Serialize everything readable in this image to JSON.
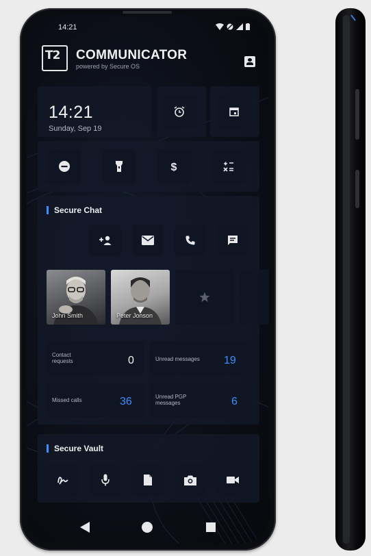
{
  "status_bar": {
    "time": "14:21"
  },
  "header": {
    "title": "COMMUNICATOR",
    "subtitle": "powered by Secure OS",
    "logo": "T2"
  },
  "clock": {
    "time": "14:21",
    "date": "Sunday, Sep 19"
  },
  "quick_actions": {
    "top": [
      "alarm-icon",
      "calendar-icon"
    ],
    "row": [
      "do-not-disturb-icon",
      "flashlight-icon",
      "dollar-icon",
      "calculator-icon"
    ]
  },
  "secure_chat": {
    "title": "Secure Chat",
    "actions": [
      "add-contact-icon",
      "mail-icon",
      "phone-icon",
      "message-icon"
    ],
    "contacts": [
      {
        "name": "John Smith"
      },
      {
        "name": "Peter Jonson"
      }
    ],
    "stats": [
      {
        "label": "Contact requests",
        "value": "0"
      },
      {
        "label": "Unread messages",
        "value": "19"
      },
      {
        "label": "Missed calls",
        "value": "36"
      },
      {
        "label": "Unread PGP messages",
        "value": "6"
      }
    ]
  },
  "secure_vault": {
    "title": "Secure Vault",
    "items": [
      "signature-icon",
      "microphone-icon",
      "document-icon",
      "camera-icon",
      "video-icon"
    ]
  },
  "navigation": [
    "back-icon",
    "home-icon",
    "recents-icon"
  ],
  "colors": {
    "accent": "#3e8eff",
    "background": "#0c0f18",
    "tile": "#131928"
  }
}
